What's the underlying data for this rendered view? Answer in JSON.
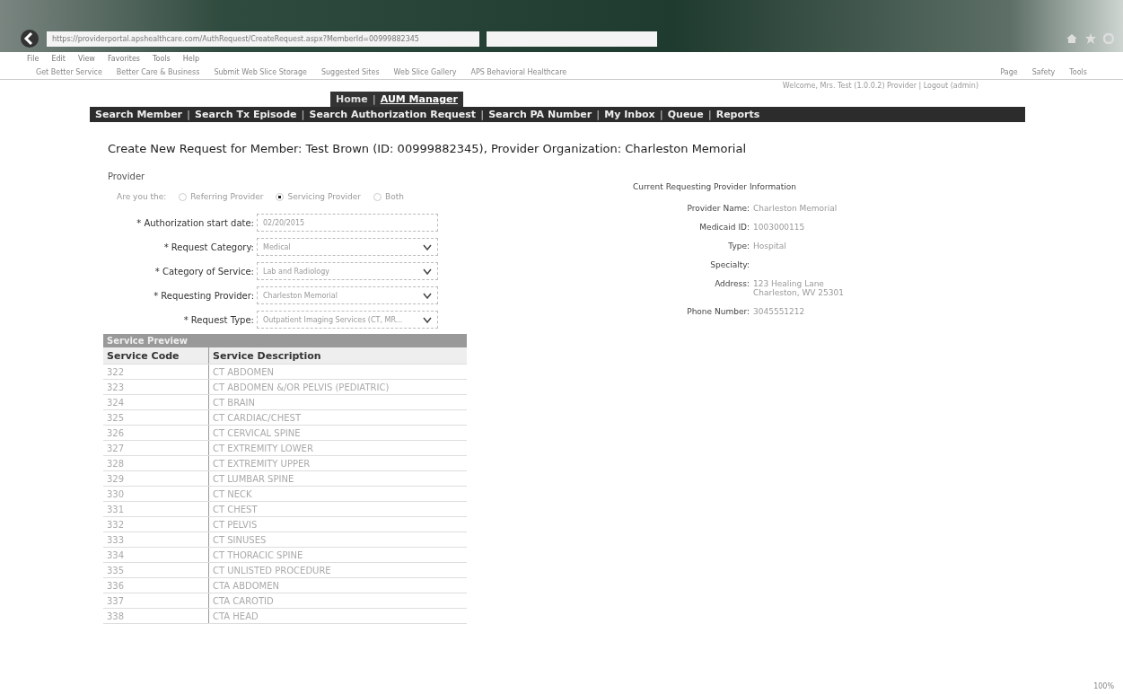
{
  "browser": {
    "address": "https://providerportal.apshealthcare.com/AuthRequest/CreateRequest.aspx?MemberId=00999882345",
    "menu": [
      "File",
      "Edit",
      "View",
      "Favorites",
      "Tools",
      "Help"
    ],
    "favorites": [
      "Get Better Service",
      "Better Care & Business",
      "Submit Web Slice Storage",
      "Suggested Sites",
      "Web Slice Gallery",
      "APS Behavioral Healthcare"
    ],
    "commands": [
      "Page",
      "Safety",
      "Tools"
    ],
    "zoom": "100%"
  },
  "user_line": "Welcome, Mrs. Test (1.0.0.2) Provider | Logout (admin)",
  "top_tabs": [
    {
      "label": "Home",
      "selected": false
    },
    {
      "label": "AUM Manager",
      "selected": true
    }
  ],
  "separator": "|",
  "nav": [
    "Search Member",
    "Search Tx Episode",
    "Search Authorization Request",
    "Search PA Number",
    "My Inbox",
    "Queue",
    "Reports"
  ],
  "title": "Create New Request for Member: Test Brown (ID: 00999882345), Provider Organization: Charleston Memorial",
  "provider": {
    "heading": "Provider",
    "question": "Are you the:",
    "options": [
      {
        "label": "Referring Provider",
        "selected": false
      },
      {
        "label": "Servicing Provider",
        "selected": true
      },
      {
        "label": "Both",
        "selected": false
      }
    ]
  },
  "fields": [
    {
      "label": "* Authorization start date:",
      "value": "02/20/2015",
      "kind": "text"
    },
    {
      "label": "* Request Category:",
      "value": "Medical",
      "kind": "select"
    },
    {
      "label": "* Category of Service:",
      "value": "Lab and Radiology",
      "kind": "select"
    },
    {
      "label": "* Requesting Provider:",
      "value": "Charleston Memorial",
      "kind": "select"
    },
    {
      "label": "* Request Type:",
      "value": "Outpatient Imaging Services (CT, MR...",
      "kind": "select"
    }
  ],
  "provider_info": {
    "heading": "Current Requesting Provider Information",
    "rows": [
      {
        "label": "Provider Name:",
        "value": [
          "Charleston Memorial"
        ]
      },
      {
        "label": "Medicaid ID:",
        "value": [
          "1003000115"
        ]
      },
      {
        "label": "Type:",
        "value": [
          "Hospital"
        ]
      },
      {
        "label": "Specialty:",
        "value": []
      },
      {
        "label": "Address:",
        "value": [
          "123 Healing Lane",
          "Charleston, WV 25301"
        ]
      },
      {
        "label": "Phone Number:",
        "value": [
          "3045551212"
        ]
      }
    ]
  },
  "service_preview": {
    "title": "Service Preview",
    "columns": [
      "Service Code",
      "Service Description"
    ],
    "rows": [
      [
        "322",
        "CT ABDOMEN"
      ],
      [
        "323",
        "CT ABDOMEN &/OR PELVIS (PEDIATRIC)"
      ],
      [
        "324",
        "CT BRAIN"
      ],
      [
        "325",
        "CT CARDIAC/CHEST"
      ],
      [
        "326",
        "CT CERVICAL SPINE"
      ],
      [
        "327",
        "CT EXTREMITY LOWER"
      ],
      [
        "328",
        "CT EXTREMITY UPPER"
      ],
      [
        "329",
        "CT LUMBAR SPINE"
      ],
      [
        "330",
        "CT NECK"
      ],
      [
        "331",
        "CT CHEST"
      ],
      [
        "332",
        "CT PELVIS"
      ],
      [
        "333",
        "CT SINUSES"
      ],
      [
        "334",
        "CT THORACIC SPINE"
      ],
      [
        "335",
        "CT UNLISTED PROCEDURE"
      ],
      [
        "336",
        "CTA ABDOMEN"
      ],
      [
        "337",
        "CTA CAROTID"
      ],
      [
        "338",
        "CTA HEAD"
      ]
    ]
  }
}
